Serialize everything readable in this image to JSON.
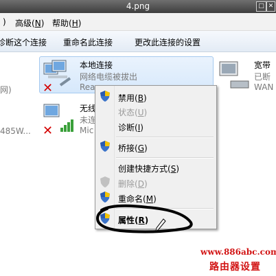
{
  "window": {
    "title": "4.png"
  },
  "menu": {
    "advanced": "高级",
    "advanced_key": "N",
    "help": "帮助",
    "help_key": "H"
  },
  "toolbar": {
    "disconnect": "诊断这个连接",
    "rename": "重命名此连接",
    "change_settings": "更改此连接的设置"
  },
  "left_partial": {
    "line1": "网)",
    "line2": "485W..."
  },
  "connections": [
    {
      "name": "本地连接",
      "status": "网络电缆被拔出",
      "device": "Rea"
    },
    {
      "name": "无线",
      "status": "未连",
      "device": "Mic"
    },
    {
      "name": "宽带",
      "status": "已断",
      "device": "WAN"
    }
  ],
  "context_menu": {
    "items": [
      {
        "label": "禁用",
        "key": "B",
        "disabled": false
      },
      {
        "label": "状态",
        "key": "U",
        "disabled": true
      },
      {
        "label": "诊断",
        "key": "I",
        "disabled": false
      },
      {
        "label": "桥接",
        "key": "G",
        "disabled": false
      },
      {
        "label": "创建快捷方式",
        "key": "S",
        "disabled": false
      },
      {
        "label": "删除",
        "key": "D",
        "disabled": true
      },
      {
        "label": "重命名",
        "key": "M",
        "disabled": false
      },
      {
        "label": "属性",
        "key": "R",
        "disabled": false
      }
    ]
  },
  "watermark": {
    "url": "www.886abc.com",
    "text": "路由器设置"
  },
  "colors": {
    "selection": "#d6e8fb",
    "watermark": "#d21414"
  }
}
